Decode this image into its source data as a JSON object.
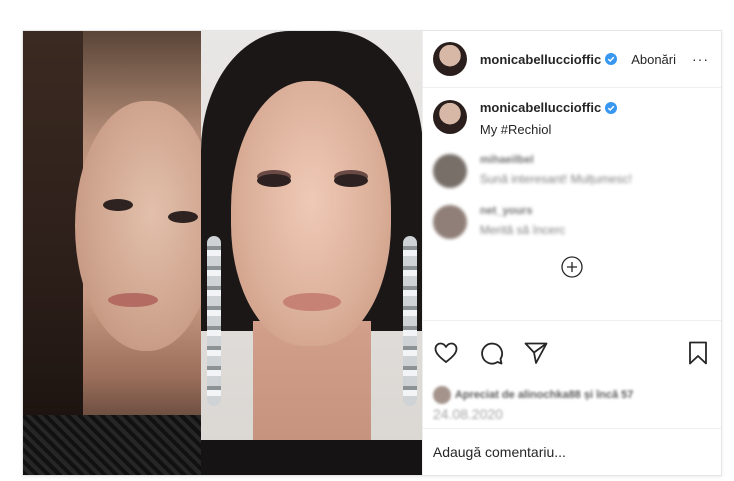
{
  "post": {
    "username": "monicabelluccioffic",
    "follow_label": "Abonări",
    "more_label": "···",
    "caption_text": "My #Rechiol",
    "comments": [
      {
        "user": "mihaeilbel",
        "text": "Sună interesant! Mulțumesc!",
        "avatar_color": "#4b3f37"
      },
      {
        "user": "net_yours",
        "text": "Merită să încerc",
        "avatar_color": "#6b554c"
      }
    ],
    "likes_text": "Apreciat de alinochka88 și încă 57",
    "date": "24.08.2020",
    "add_comment_placeholder": "Adaugă comentariu..."
  },
  "icons": {
    "verified": "verified-badge-icon",
    "like": "heart-icon",
    "comment": "comment-icon",
    "share": "send-icon",
    "save": "bookmark-icon",
    "load_more": "plus-circle-icon"
  },
  "colors": {
    "verified_blue": "#3897f0",
    "text": "#262626",
    "muted": "#8e8e8e",
    "divider": "#efefef"
  }
}
